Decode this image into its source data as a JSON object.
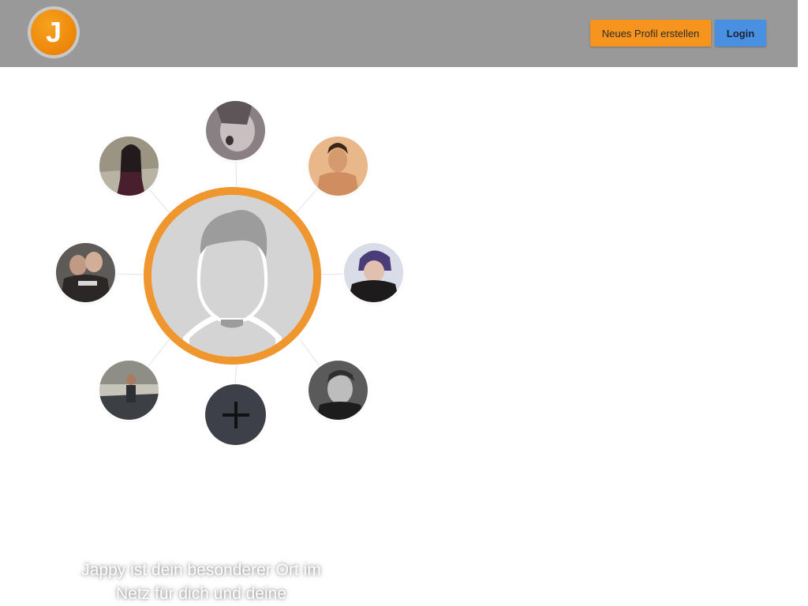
{
  "header": {
    "logo_letter": "J",
    "register_label": "Neues Profil erstellen",
    "login_label": "Login"
  },
  "hero": {
    "tagline": "Jappy ist dein besonderer Ort im Netz für dich und deine"
  },
  "colors": {
    "header_bg": "#999999",
    "brand_orange": "#f7941d",
    "login_blue": "#4a90e2",
    "add_button": "#3d4048"
  },
  "icons": [
    "jappy-logo-icon",
    "default-profile-silhouette-icon",
    "plus-icon"
  ]
}
